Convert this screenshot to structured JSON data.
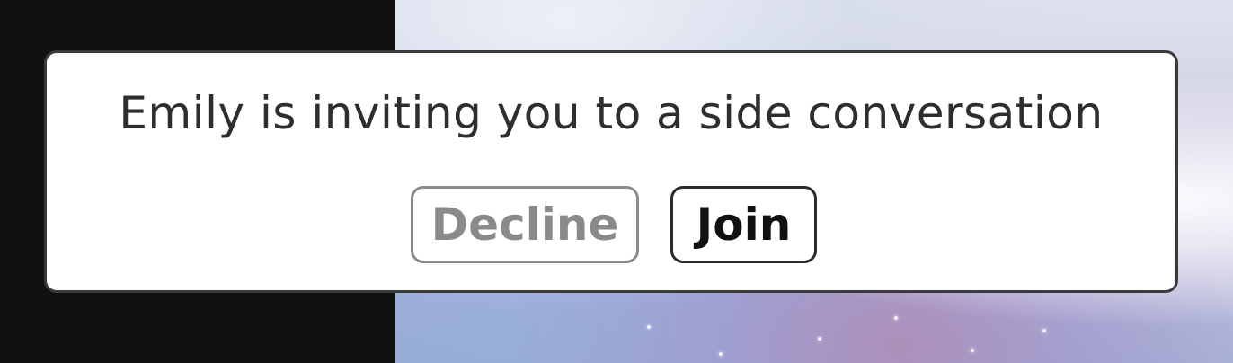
{
  "invite": {
    "message": "Emily is inviting you to a side conversation",
    "decline_label": "Decline",
    "join_label": "Join"
  },
  "colors": {
    "dialog_background": "#ffffff",
    "dialog_border": "#3a3a3a",
    "message_text": "#2e2e2e",
    "decline_text": "#8a8a8a",
    "join_text": "#111111",
    "left_panel": "#111111"
  }
}
